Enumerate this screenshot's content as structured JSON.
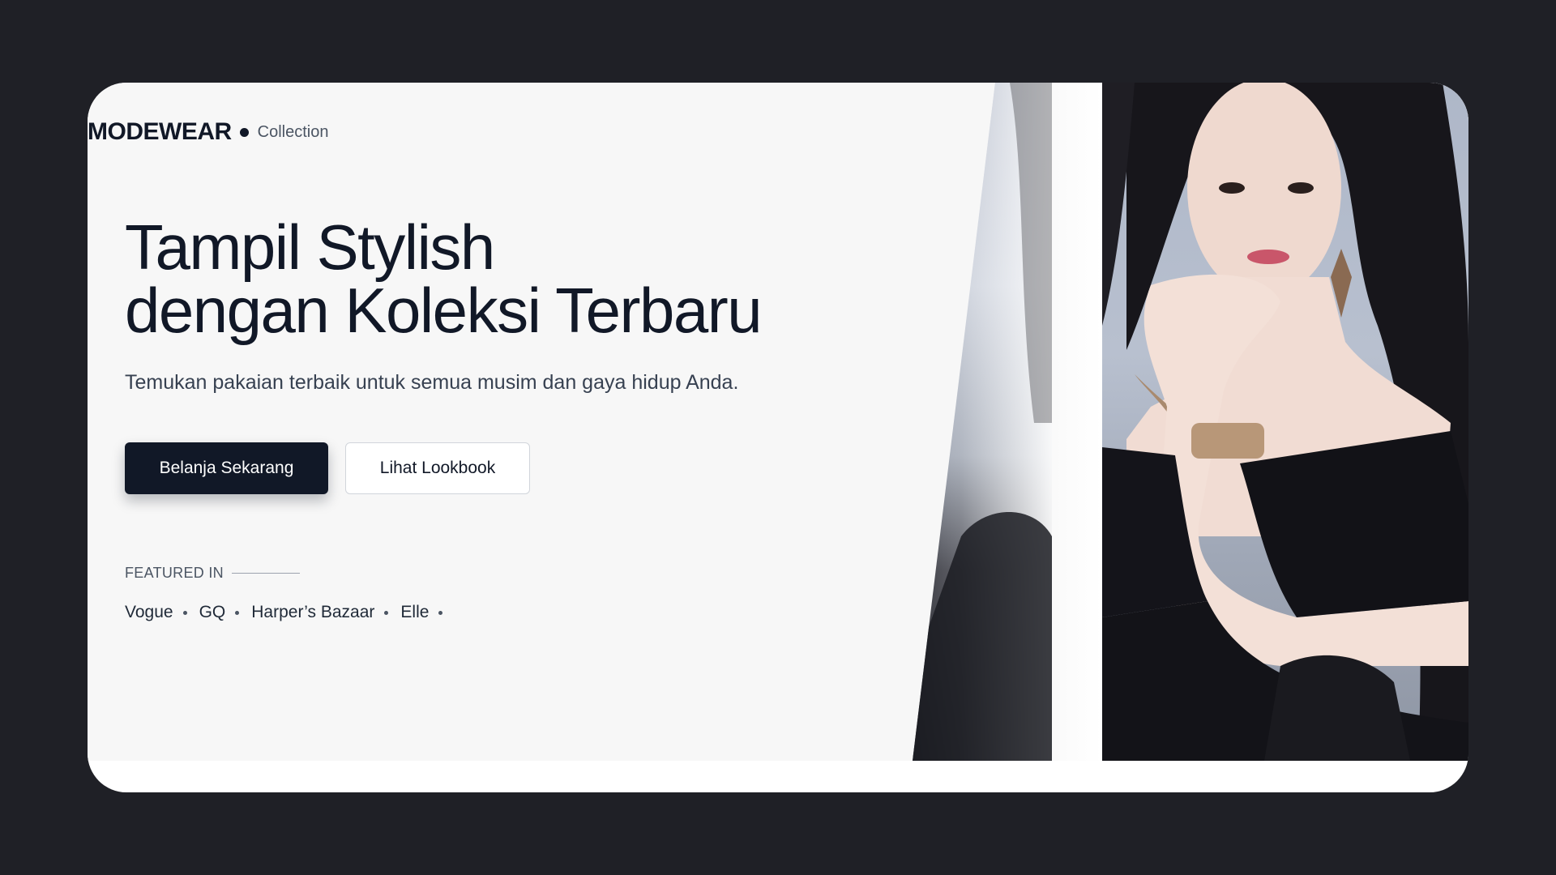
{
  "brand": {
    "name": "MODEWEAR",
    "sub": "Collection"
  },
  "hero": {
    "headline_line1": "Tampil Stylish",
    "headline_line2": "dengan Koleksi Terbaru",
    "subtitle": "Temukan pakaian terbaik untuk semua musim dan gaya hidup Anda."
  },
  "buttons": {
    "primary_label": "Belanja Sekarang",
    "secondary_label": "Lihat Lookbook"
  },
  "featured": {
    "label": "FEATURED IN",
    "items": [
      "Vogue",
      "GQ",
      "Harper’s Bazaar",
      "Elle"
    ]
  },
  "colors": {
    "page_background": "#1f2026",
    "hero_background": "#f7f7f7",
    "primary": "#111827"
  }
}
